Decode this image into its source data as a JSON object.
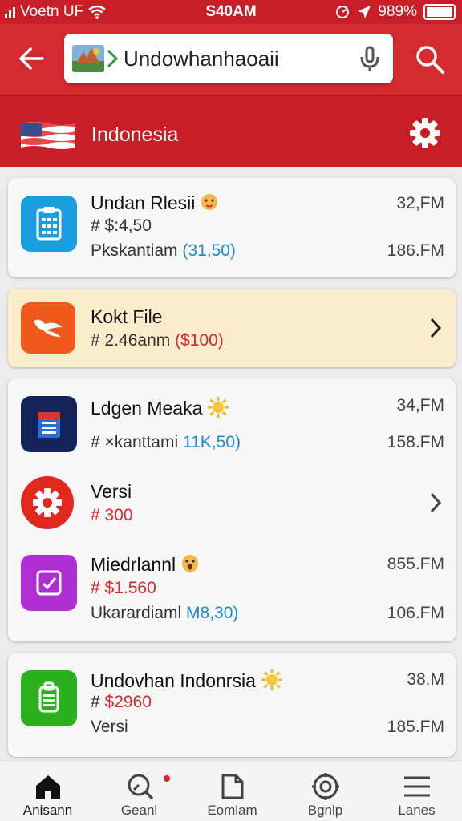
{
  "status_bar": {
    "carrier": "Voetn UF",
    "time": "S40AM",
    "battery": "989%"
  },
  "app_bar": {
    "search_value": "Undowhanhaoaii"
  },
  "region": {
    "label": "Indonesia"
  },
  "cards": [
    {
      "items": [
        {
          "title": "Undan Rlesii",
          "line1": "# $:4,50",
          "line2_prefix": "Pkskantiam",
          "line2_highlight": "(31,50)",
          "meta1": "32,FM",
          "meta2": "186.FM",
          "icon": "clipboard-icon",
          "icon_color": "#1a9ee0"
        }
      ]
    },
    {
      "items": [
        {
          "title": "Kokt File",
          "line1_prefix": "# 2.46anm",
          "line1_highlight": "($100)",
          "icon": "wings-icon",
          "icon_color": "#f0591c"
        }
      ]
    },
    {
      "items": [
        {
          "title": "Ldgen Meaka",
          "line1_prefix": "# ×kanttami",
          "line1_highlight": "11K,50)",
          "meta1": "34,FM",
          "meta2": "158.FM",
          "icon": "calendar-icon",
          "icon_color": "#14235a"
        },
        {
          "title": "Versi",
          "line1": "# 300",
          "icon": "gear-icon",
          "icon_color": "#e0281e"
        },
        {
          "title": "Miedrlannl",
          "line1": "# $1.560",
          "line2_prefix": "Ukarardiaml",
          "line2_highlight": "M8,30)",
          "meta1": "855.FM",
          "meta2": "106.FM",
          "icon": "checkbox-icon",
          "icon_color": "#b02fd2"
        }
      ]
    },
    {
      "items": [
        {
          "title": "Undovhan Indonrsia",
          "line1_prefix": "#",
          "line1_highlight": "$2960",
          "line2": "Versi",
          "meta1": "38.M",
          "meta2": "185.FM",
          "icon": "receipt-icon",
          "icon_color": "#2bb01e"
        }
      ]
    }
  ],
  "bottom_nav": [
    {
      "label": "Anisann",
      "icon": "home-icon"
    },
    {
      "label": "Geanl",
      "icon": "search-icon"
    },
    {
      "label": "Eomlam",
      "icon": "document-icon"
    },
    {
      "label": "Bgnlp",
      "icon": "location-icon"
    },
    {
      "label": "Lanes",
      "icon": "menu-icon"
    }
  ],
  "colors": {
    "primary": "#d42a30",
    "primary_dark": "#c81e27",
    "highlight_card": "#fbeccb",
    "link_blue": "#1e88c8",
    "price_red": "#d8262c"
  }
}
